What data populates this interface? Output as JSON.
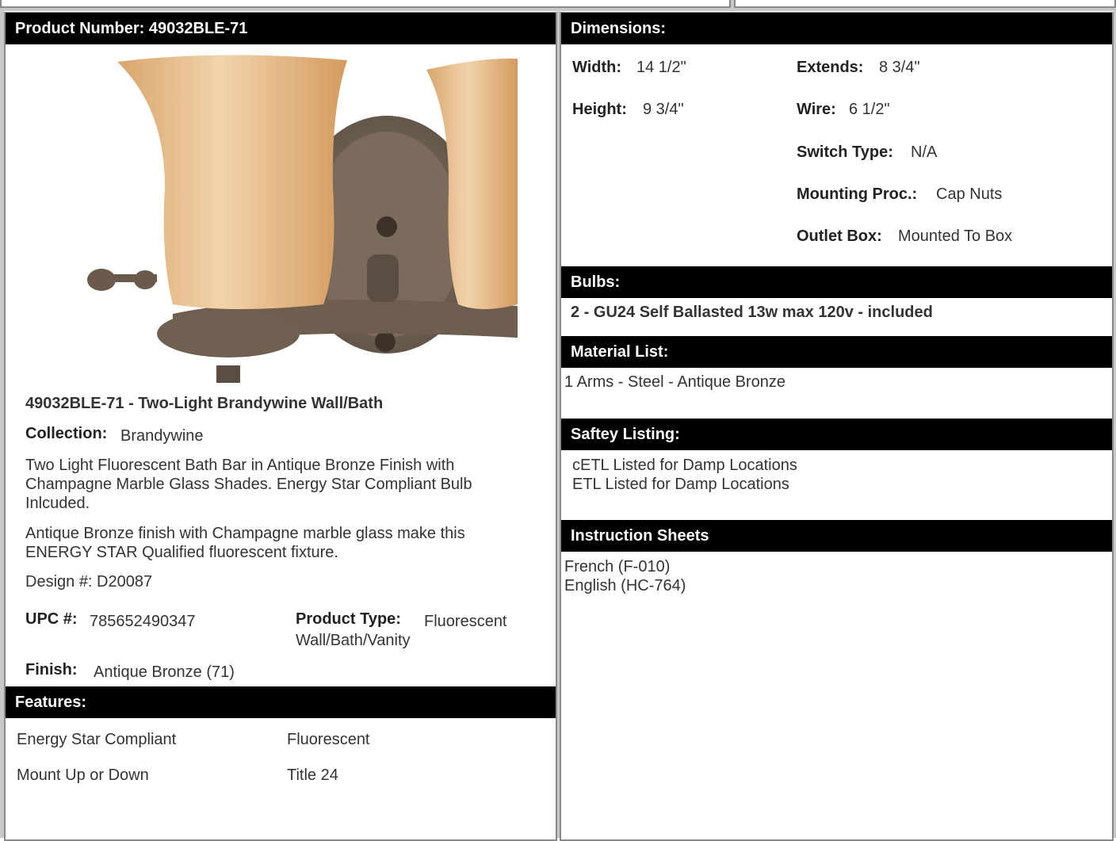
{
  "colors": {
    "header_bg": "#000000",
    "header_text": "#ffffff",
    "border": "#8a8a8a",
    "frame": "#c8c8c8"
  },
  "left": {
    "header": "Product Number: 49032BLE-71",
    "image_icon": "wall-light-fixture-image",
    "title": "49032BLE-71 - Two-Light Brandywine Wall/Bath",
    "collection_label": "Collection:",
    "collection_value": "Brandywine",
    "desc1_line1": "Two Light Fluorescent Bath Bar in Antique Bronze Finish with",
    "desc1_line2": "Champagne Marble Glass Shades. Energy Star Compliant Bulb",
    "desc1_line3": "Inlcuded.",
    "desc2_line1": "Antique Bronze finish with Champagne marble glass make this",
    "desc2_line2": "ENERGY STAR Qualified fluorescent fixture.",
    "design": "Design #: D20087",
    "upc_label": "UPC #:",
    "upc_value": "785652490347",
    "type_label": "Product Type:",
    "type_value_1": "Fluorescent",
    "type_value_2": "Wall/Bath/Vanity",
    "finish_label": "Finish:",
    "finish_value": "Antique Bronze (71)",
    "features_header": "Features:",
    "features": [
      "Energy Star Compliant",
      "Fluorescent",
      "Mount Up or Down",
      "Title 24"
    ]
  },
  "right": {
    "dimensions_header": "Dimensions:",
    "width_label": "Width:",
    "width_value": "14 1/2\"",
    "extends_label": "Extends:",
    "extends_value": "8 3/4\"",
    "height_label": "Height:",
    "height_value": "9 3/4\"",
    "wire_label": "Wire:",
    "wire_value": "6 1/2\"",
    "switch_label": "Switch Type:",
    "switch_value": "N/A",
    "mounting_label": "Mounting Proc.:",
    "mounting_value": "Cap Nuts",
    "outlet_label": "Outlet Box:",
    "outlet_value": "Mounted To Box",
    "bulbs_header": "Bulbs:",
    "bulbs_value": "2 - GU24 Self Ballasted 13w max 120v - included",
    "material_header": "Material List:",
    "material_value": "1 Arms - Steel - Antique Bronze",
    "safety_header": "Saftey Listing:",
    "safety_1": "cETL Listed for Damp Locations",
    "safety_2": "ETL Listed for Damp Locations",
    "instructions_header": "Instruction Sheets",
    "instruction_1": "French (F-010)",
    "instruction_2": "English (HC-764)"
  }
}
